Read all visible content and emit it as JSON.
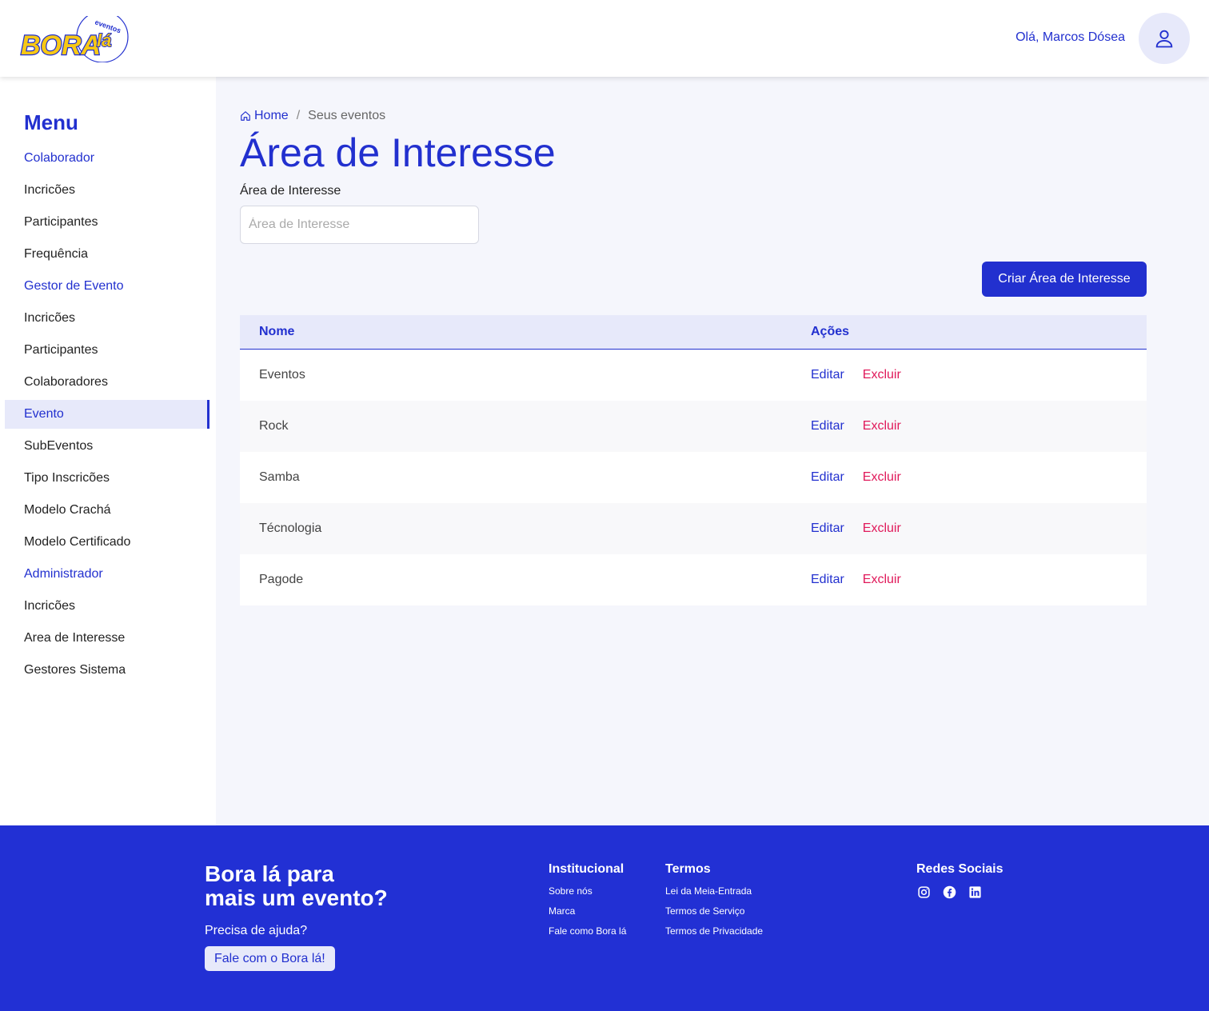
{
  "header": {
    "logo_text": "BORA lá",
    "logo_sub": "eventos",
    "greeting": "Olá, Marcos Dósea",
    "user_icon": "user-icon"
  },
  "sidebar": {
    "title": "Menu",
    "items": [
      {
        "label": "Colaborador",
        "type": "section"
      },
      {
        "label": "Incricões",
        "type": "link"
      },
      {
        "label": "Participantes",
        "type": "link"
      },
      {
        "label": "Frequência",
        "type": "link"
      },
      {
        "label": "Gestor de Evento",
        "type": "section"
      },
      {
        "label": "Incricões",
        "type": "link"
      },
      {
        "label": "Participantes",
        "type": "link"
      },
      {
        "label": "Colaboradores",
        "type": "link"
      },
      {
        "label": "Evento",
        "type": "active"
      },
      {
        "label": "SubEventos",
        "type": "link"
      },
      {
        "label": "Tipo Inscricões",
        "type": "link"
      },
      {
        "label": "Modelo Crachá",
        "type": "link"
      },
      {
        "label": "Modelo Certificado",
        "type": "link"
      },
      {
        "label": "Administrador",
        "type": "section"
      },
      {
        "label": "Incricões",
        "type": "link"
      },
      {
        "label": "Area de Interesse",
        "type": "link"
      },
      {
        "label": "Gestores Sistema",
        "type": "link"
      }
    ]
  },
  "breadcrumb": {
    "home_icon": "home-icon",
    "home": "Home",
    "separator": "/",
    "current": "Seus eventos"
  },
  "page": {
    "title": "Área de Interesse",
    "field_label": "Área de Interesse",
    "field_placeholder": "Área de Interesse",
    "field_value": "",
    "create_button": "Criar Área de Interesse"
  },
  "table": {
    "columns": [
      "Nome",
      "Ações"
    ],
    "rows": [
      {
        "name": "Eventos",
        "edit": "Editar",
        "delete": "Excluir"
      },
      {
        "name": "Rock",
        "edit": "Editar",
        "delete": "Excluir"
      },
      {
        "name": "Samba",
        "edit": "Editar",
        "delete": "Excluir"
      },
      {
        "name": "Técnologia",
        "edit": "Editar",
        "delete": "Excluir"
      },
      {
        "name": "Pagode",
        "edit": "Editar",
        "delete": "Excluir"
      }
    ]
  },
  "footer": {
    "headline_1": "Bora lá para",
    "headline_2": "mais um evento?",
    "help": "Precisa de ajuda?",
    "help_button": "Fale com o Bora lá!",
    "institucional": {
      "title": "Institucional",
      "links": [
        "Sobre nós",
        "Marca",
        "Fale como Bora lá"
      ]
    },
    "termos": {
      "title": "Termos",
      "links": [
        "Lei da Meia-Entrada",
        "Termos de Serviço",
        "Termos de Privacidade"
      ]
    },
    "social": {
      "title": "Redes Sociais",
      "icons": [
        "instagram-icon",
        "facebook-icon",
        "linkedin-icon"
      ]
    }
  },
  "colors": {
    "primary": "#2230cf",
    "danger": "#e0195a",
    "footer_bg": "#2230d4",
    "logo_yellow": "#f7c815",
    "page_bg": "#f5f6fc"
  }
}
